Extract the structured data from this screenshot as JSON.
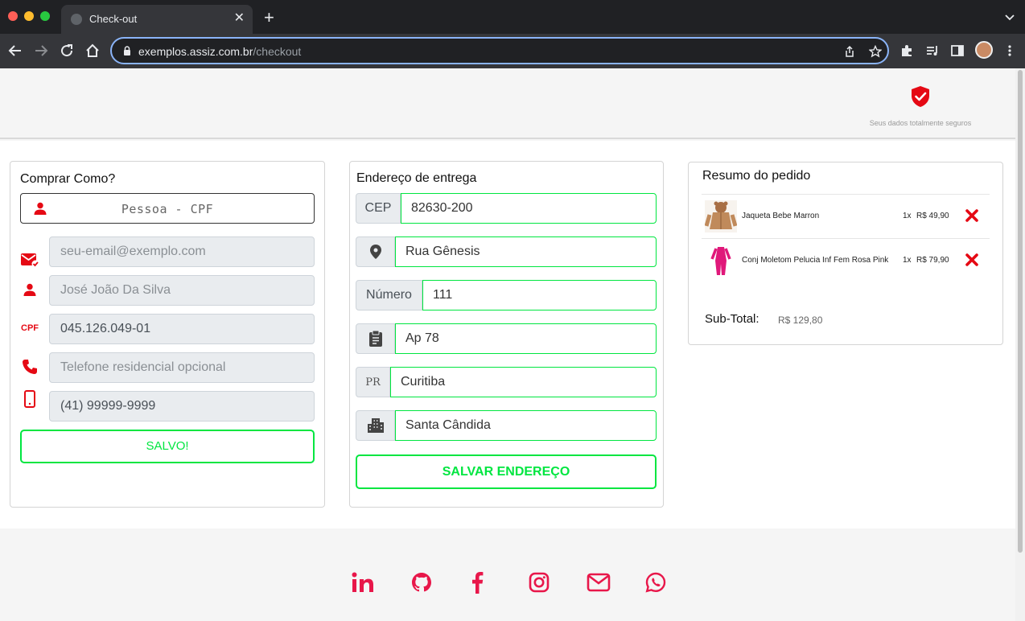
{
  "browser": {
    "tab_title": "Check-out",
    "tab_close": "✕",
    "new_tab": "+",
    "url_host": "exemplos.assiz.com.br",
    "url_path": "/checkout"
  },
  "header": {
    "secure_text": "Seus dados totalmente seguros"
  },
  "buyer": {
    "title": "Comprar Como?",
    "type_selected": "Pessoa - CPF",
    "email_placeholder": "seu-email@exemplo.com",
    "name": "José João Da Silva",
    "cpf_icon_label": "CPF",
    "cpf": "045.126.049-01",
    "phone_placeholder": "Telefone residencial opcional",
    "mobile": "(41) 99999-9999",
    "saved_label": "SALVO!"
  },
  "address": {
    "title": "Endereço de entrega",
    "cep_label": "CEP",
    "cep": "82630-200",
    "street": "Rua Gênesis",
    "number_label": "Número",
    "number": "111",
    "complement": "Ap 78",
    "state_label": "PR",
    "city": "Curitiba",
    "district": "Santa Cândida",
    "save_label": "SALVAR ENDEREÇO"
  },
  "summary": {
    "title": "Resumo do pedido",
    "items": [
      {
        "name": "Jaqueta Bebe Marron",
        "qty": "1x",
        "price": "R$ 49,90"
      },
      {
        "name": "Conj Moletom Pelucia Inf Fem Rosa Pink",
        "qty": "1x",
        "price": "R$ 79,90"
      }
    ],
    "subtotal_label": "Sub-Total:",
    "subtotal_value": "R$ 129,80"
  },
  "colors": {
    "brand_red": "#e50914",
    "success_green": "#00e640",
    "footer_icon": "#e8174a"
  },
  "footer_icons": [
    "linkedin-icon",
    "github-icon",
    "facebook-icon",
    "instagram-icon",
    "mail-icon",
    "whatsapp-icon"
  ]
}
